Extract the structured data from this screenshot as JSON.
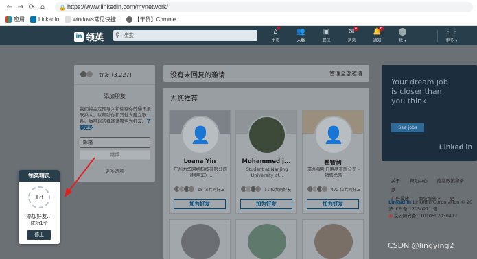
{
  "browser": {
    "url": "https://www.linkedin.com/mynetwork/",
    "bookmarks": [
      "应用",
      "LinkedIn",
      "windows常见快捷...",
      "【干货】Chrome..."
    ]
  },
  "linkedin": {
    "brand": "领英",
    "search_placeholder": "搜索",
    "nav": [
      {
        "label": "主页",
        "badge": ""
      },
      {
        "label": "人脉",
        "badge": ""
      },
      {
        "label": "职位",
        "badge": ""
      },
      {
        "label": "消息",
        "badge": "4"
      },
      {
        "label": "通知",
        "badge": "6"
      },
      {
        "label": "我 ▾",
        "badge": ""
      }
    ],
    "more_label": "更多 ▾"
  },
  "left_panel": {
    "friends_label": "好友 (3,227)",
    "add_friends_title": "添加朋友",
    "description": "我们将会定期导入和储存你的通讯录联系人，以帮助你和其他人建立联系。你可以选择邀请哪些为好友。",
    "learn_more": "了解更多",
    "email_value": "邮箱",
    "continue_button": "继续",
    "more_options": "更多选项"
  },
  "invitations": {
    "title": "没有未回复的邀请",
    "manage_label": "管理全部邀请"
  },
  "recommendations": {
    "title": "为您推荐",
    "people": [
      {
        "name": "Loana Yin",
        "desc": "广州力华网络科技有限公司（租用车）...",
        "mutual": "18 位共同好友",
        "button": "加为好友"
      },
      {
        "name": "Mohammed j...",
        "desc": "Student at Nanjing University of...",
        "mutual": "11 位共同好友",
        "button": "加为好友"
      },
      {
        "name": "翟智漪",
        "desc": "苏州绿叶日用品有限公司 - 销售总监",
        "mutual": "472 位共同好友",
        "button": "加为好友"
      }
    ]
  },
  "ad": {
    "text": "Your dream job is closer than you think",
    "button": "See jobs",
    "logo": "Linked in"
  },
  "footer": {
    "links_row1": [
      "关于",
      "帮助中心",
      "隐私政策和条款"
    ],
    "links_row2": [
      "广告投放",
      "商业服务 ▾",
      "更"
    ],
    "corp_line1": "LinkedIn Corporation © 20",
    "corp_line2": "沪 ICP 备 17050271 号",
    "corp_line3": "京公网安备 11010502030412"
  },
  "bot": {
    "title": "领英精灵",
    "counter": "18",
    "status": "添加好友...",
    "success": "成功1个",
    "stop_button": "停止"
  },
  "watermark": "CSDN @lingying2",
  "colors": {
    "linkedin_nav": "#283e4a",
    "linkedin_blue": "#0073b1",
    "overlay": "#6b7075"
  }
}
